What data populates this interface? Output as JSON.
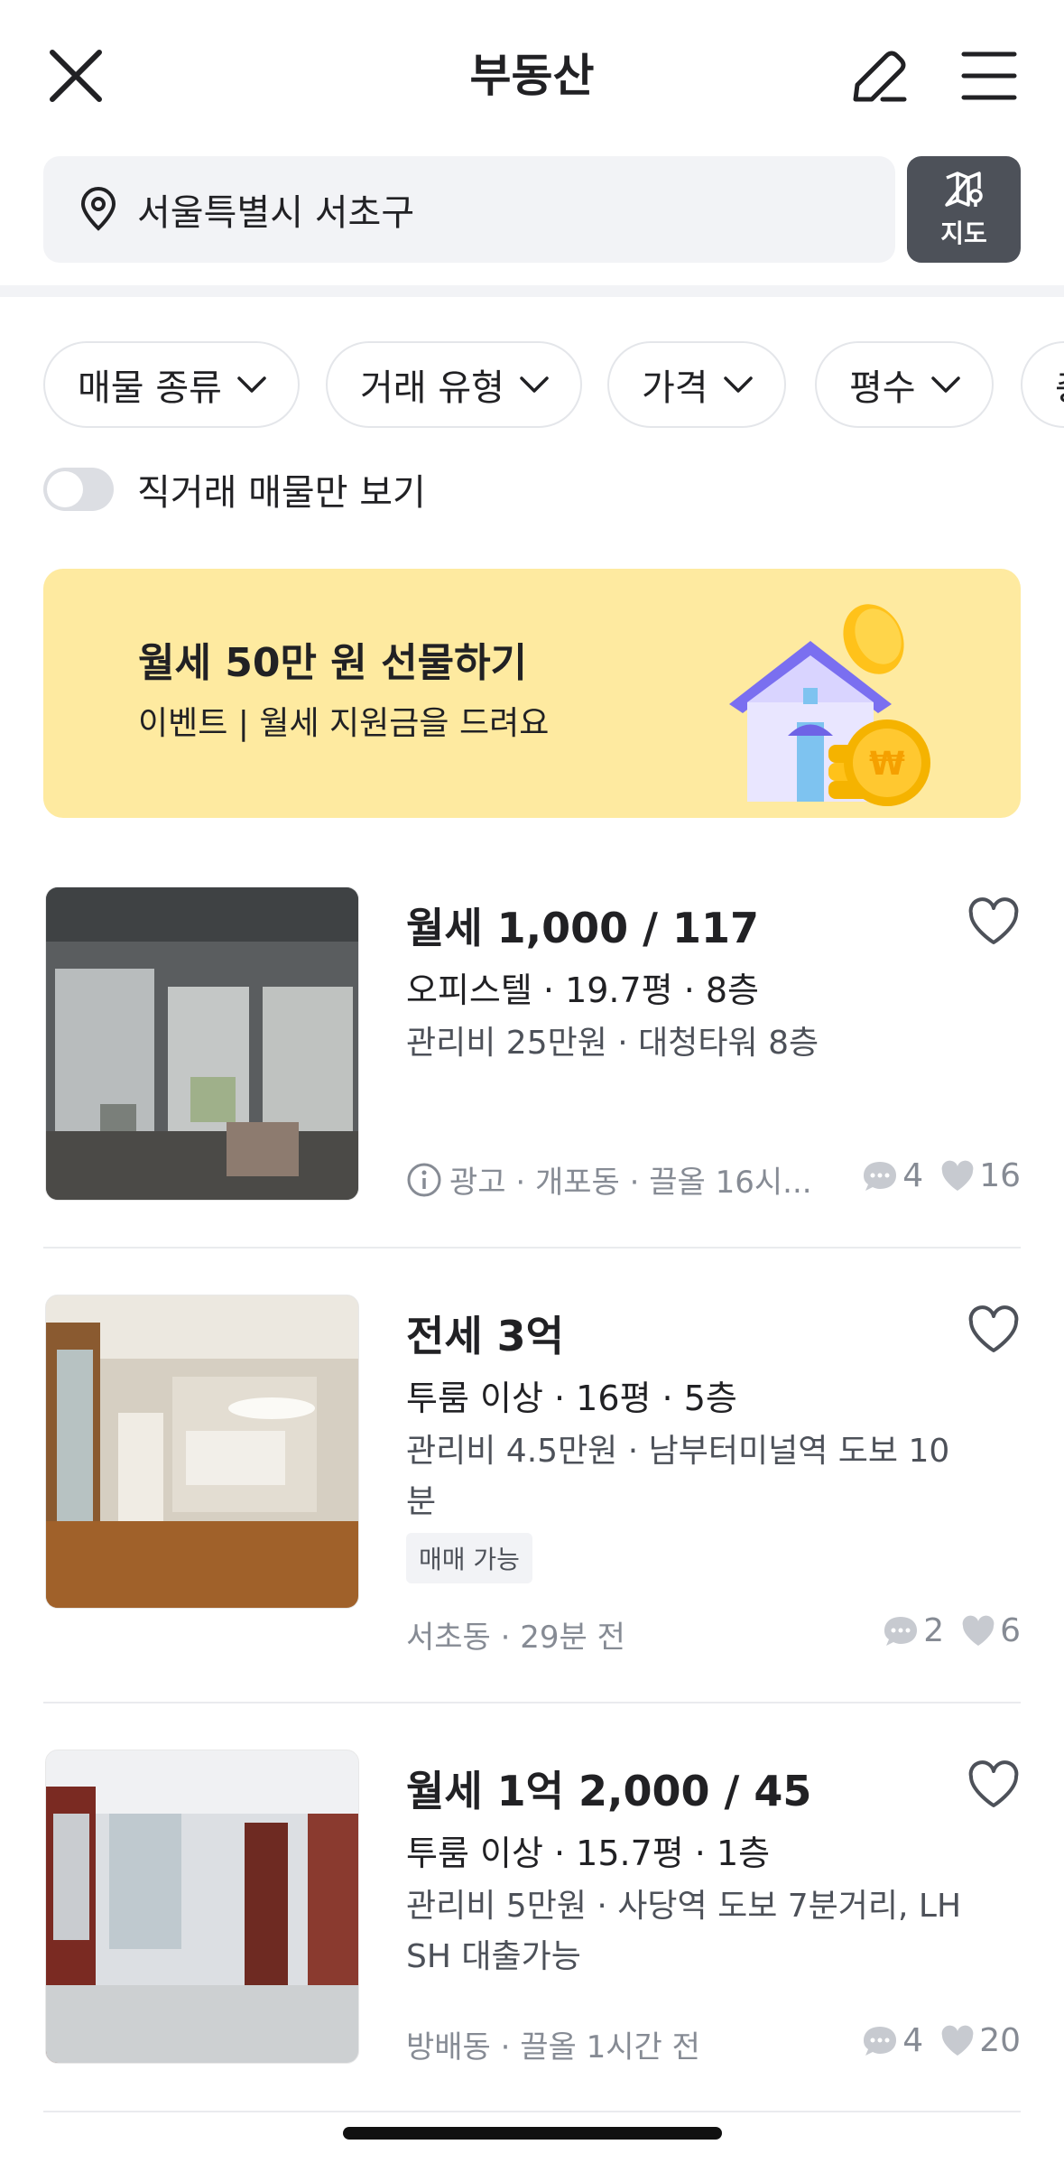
{
  "header": {
    "title": "부동산"
  },
  "search": {
    "location": "서울특별시 서초구",
    "map_label": "지도"
  },
  "filters": [
    {
      "label": "매물 종류"
    },
    {
      "label": "거래 유형"
    },
    {
      "label": "가격"
    },
    {
      "label": "평수"
    },
    {
      "label": "층"
    }
  ],
  "toggle": {
    "label": "직거래 매물만 보기",
    "on": false
  },
  "banner": {
    "title": "월세 50만 원 선물하기",
    "subtitle": "이벤트 | 월세 지원금을 드려요"
  },
  "listings": [
    {
      "price": "월세 1,000 / 117",
      "spec": "오피스텔 · 19.7평 · 8층",
      "detail": "관리비 25만원 · 대청타워 8층",
      "tag": "",
      "meta": "광고 · 개포동 · 끌올 16시...",
      "chats": "4",
      "likes": "16"
    },
    {
      "price": "전세 3억",
      "spec": "투룸 이상 · 16평 · 5층",
      "detail": "관리비 4.5만원 · 남부터미널역 도보 10분",
      "tag": "매매 가능",
      "meta": "서초동 · 29분 전",
      "chats": "2",
      "likes": "6"
    },
    {
      "price": "월세 1억 2,000 / 45",
      "spec": "투룸 이상 · 15.7평 · 1층",
      "detail": "관리비 5만원 · 사당역 도보 7분거리, LH SH 대출가능",
      "tag": "",
      "meta": "방배동 · 끌올 1시간 전",
      "chats": "4",
      "likes": "20"
    }
  ]
}
